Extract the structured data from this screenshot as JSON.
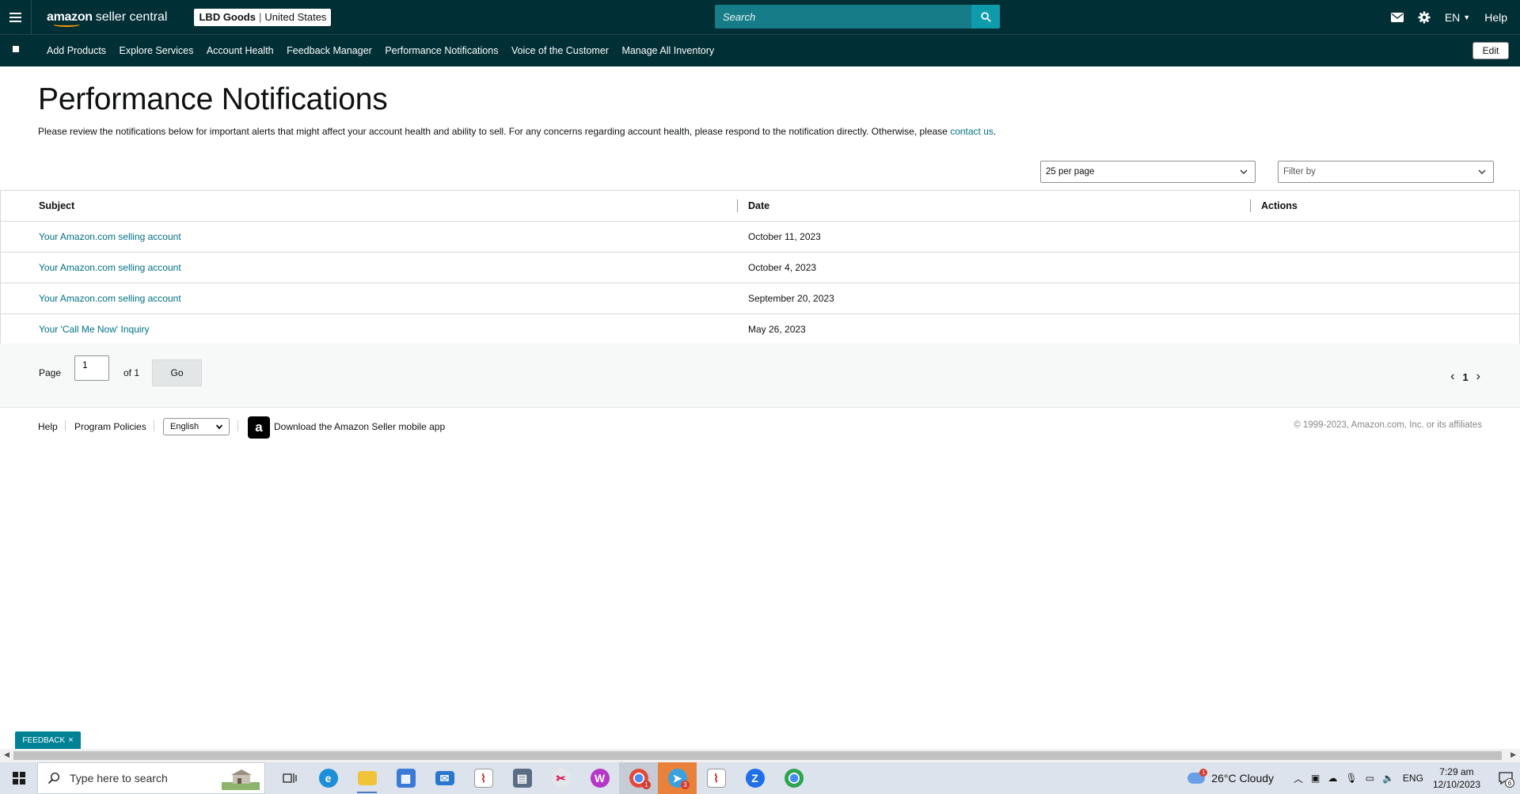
{
  "header": {
    "logo_bold": "amazon",
    "logo_light": "seller central",
    "store_name": "LBD Goods",
    "store_sep": "|",
    "store_region": "United States",
    "search_placeholder": "Search",
    "language": "EN",
    "help": "Help"
  },
  "nav": {
    "items": [
      "Add Products",
      "Explore Services",
      "Account Health",
      "Feedback Manager",
      "Performance Notifications",
      "Voice of the Customer",
      "Manage All Inventory"
    ],
    "edit": "Edit"
  },
  "main": {
    "title": "Performance Notifications",
    "intro": "Please review the notifications below for important alerts that might affect your account health and ability to sell. For any concerns regarding account health, please respond to the notification directly. Otherwise, please ",
    "intro_link": "contact us",
    "intro_end": ".",
    "per_page": "25 per page",
    "filter_placeholder": "Filter by",
    "table": {
      "headers": [
        "Subject",
        "Date",
        "Actions"
      ],
      "rows": [
        {
          "subject": "Your Amazon.com selling account",
          "date": "October 11, 2023"
        },
        {
          "subject": "Your Amazon.com selling account",
          "date": "October 4, 2023"
        },
        {
          "subject": "Your Amazon.com selling account",
          "date": "September 20, 2023"
        },
        {
          "subject": "Your 'Call Me Now' Inquiry",
          "date": "May 26, 2023"
        }
      ]
    },
    "pager": {
      "page_label": "Page",
      "page_value": "1",
      "of_label": "of 1",
      "go": "Go",
      "current": "1"
    }
  },
  "footer": {
    "help": "Help",
    "policies": "Program Policies",
    "language": "English",
    "app_icon_letter": "a",
    "app_text": "Download the Amazon Seller mobile app",
    "copyright": "© 1999-2023, Amazon.com, Inc. or its affiliates"
  },
  "feedback": {
    "label": "FEEDBACK",
    "close": "×"
  },
  "taskbar": {
    "search_placeholder": "Type here to search",
    "weather": "26°C  Cloudy",
    "weather_badge": "1",
    "lang": "ENG",
    "time": "7:29 am",
    "date": "12/10/2023",
    "notif_count": "6",
    "chrome_badge": "1",
    "app_badge": "3"
  },
  "colors": {
    "header_bg": "#002f36",
    "search_bg": "#167d88",
    "link": "#007185",
    "feedback_bg": "#008296"
  }
}
